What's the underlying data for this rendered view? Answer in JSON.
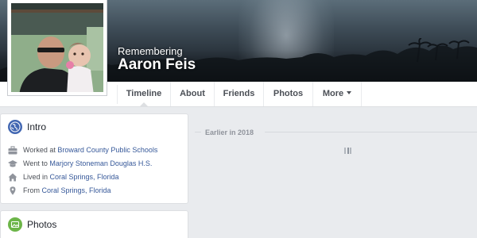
{
  "header": {
    "memorial_label": "Remembering",
    "name": "Aaron Feis"
  },
  "nav": {
    "tabs": [
      {
        "label": "Timeline",
        "active": true
      },
      {
        "label": "About",
        "active": false
      },
      {
        "label": "Friends",
        "active": false
      },
      {
        "label": "Photos",
        "active": false
      },
      {
        "label": "More",
        "active": false
      }
    ],
    "more_icon": "caret-down-icon"
  },
  "intro": {
    "title": "Intro",
    "icon": "globe-icon",
    "items": [
      {
        "icon": "briefcase-icon",
        "prefix": "Worked at ",
        "link": "Broward County Public Schools"
      },
      {
        "icon": "graduation-cap-icon",
        "prefix": "Went to ",
        "link": "Marjory Stoneman Douglas H.S."
      },
      {
        "icon": "home-icon",
        "prefix": "Lived in ",
        "link": "Coral Springs, Florida"
      },
      {
        "icon": "location-pin-icon",
        "prefix": "From ",
        "link": "Coral Springs, Florida"
      }
    ]
  },
  "photos": {
    "title": "Photos",
    "icon": "photos-icon"
  },
  "timeline": {
    "section_label": "Earlier in 2018",
    "loading": true
  },
  "colors": {
    "link": "#365899",
    "text": "#4b4f56",
    "muted": "#90949c",
    "background": "#e9ebee",
    "globe": "#4267b2",
    "photos": "#6cb548"
  }
}
